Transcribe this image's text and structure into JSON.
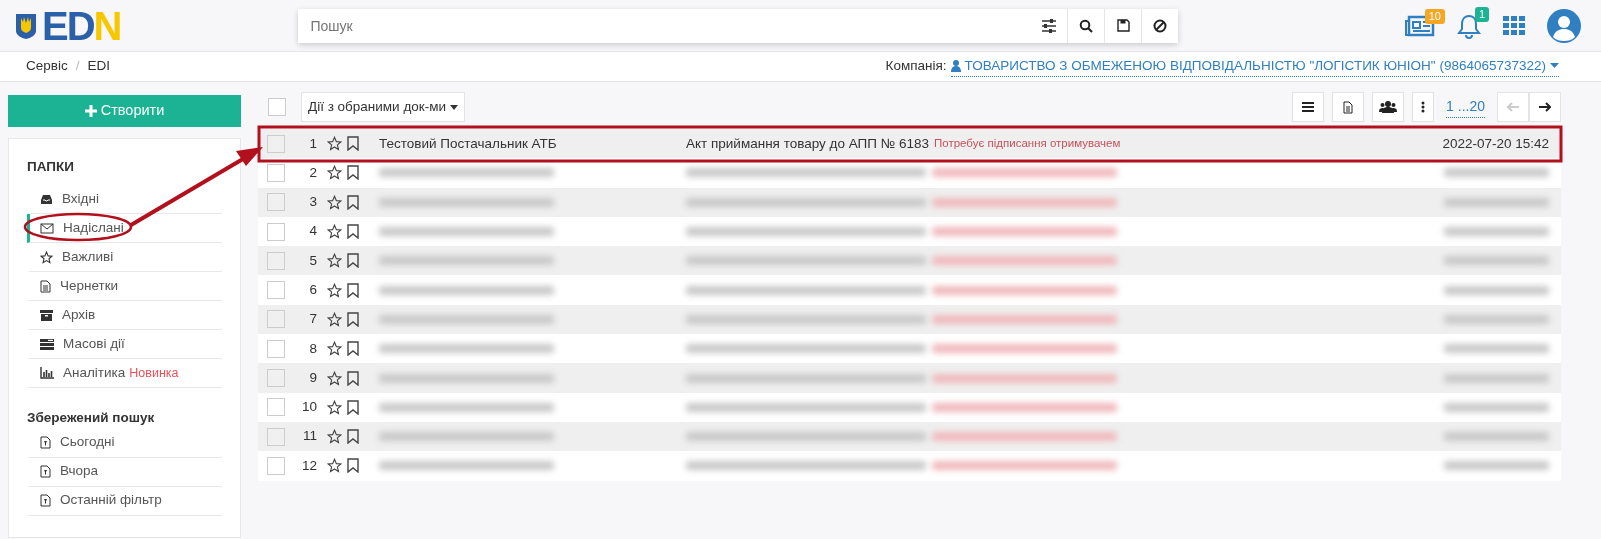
{
  "header": {
    "logo_letters": [
      "ED",
      "N"
    ],
    "search": {
      "placeholder": "Пошук"
    },
    "news_badge": "10",
    "notifications_badge": "1"
  },
  "breadcrumb": {
    "items": [
      "Сервіс",
      "EDI"
    ],
    "separator": "/"
  },
  "company": {
    "label": "Компанія:",
    "name": "ТОВАРИСТВО З ОБМЕЖЕНОЮ ВІДПОВІДАЛЬНІСТЮ \"ЛОГІСТИК ЮНІОН\" (9864065737322)"
  },
  "create_button": "Створити",
  "sidebar": {
    "folders_title": "ПАПКИ",
    "folders": [
      {
        "label": "Вхідні",
        "selected": false
      },
      {
        "label": "Надіслані",
        "selected": true
      },
      {
        "label": "Важливі",
        "selected": false
      },
      {
        "label": "Чернетки",
        "selected": false
      },
      {
        "label": "Архів",
        "selected": false
      },
      {
        "label": "Масові дії",
        "selected": false
      },
      {
        "label": "Аналітика",
        "badge": "Новинка",
        "selected": false
      }
    ],
    "saved_title": "Збережений пошук",
    "saved": [
      {
        "label": "Сьогодні"
      },
      {
        "label": "Вчора"
      },
      {
        "label": "Останній фільтр"
      }
    ]
  },
  "toolbar": {
    "select_all_checked": false,
    "actions_button": "Дії з обраними док-ми",
    "range": "1 ...20"
  },
  "rows": [
    {
      "kind": "visible",
      "number": "1",
      "sender": "Тестовий Постачальник АТБ",
      "document": "Акт приймання товару до АПП № 6183",
      "status": "Потребує підписання отримувачем",
      "date": "2022-07-20 15:42",
      "checked": false
    },
    {
      "kind": "blurred",
      "number": "2",
      "checked": false
    },
    {
      "kind": "blurred",
      "number": "3",
      "checked": false
    },
    {
      "kind": "blurred",
      "number": "4",
      "checked": false
    },
    {
      "kind": "blurred",
      "number": "5",
      "checked": false
    },
    {
      "kind": "blurred",
      "number": "6",
      "checked": false
    },
    {
      "kind": "blurred",
      "number": "7",
      "checked": false
    },
    {
      "kind": "blurred",
      "number": "8",
      "checked": false
    },
    {
      "kind": "blurred",
      "number": "9",
      "checked": false
    },
    {
      "kind": "blurred",
      "number": "10",
      "checked": false
    },
    {
      "kind": "blurred",
      "number": "11",
      "checked": false
    },
    {
      "kind": "blurred",
      "number": "12",
      "checked": false
    }
  ]
}
